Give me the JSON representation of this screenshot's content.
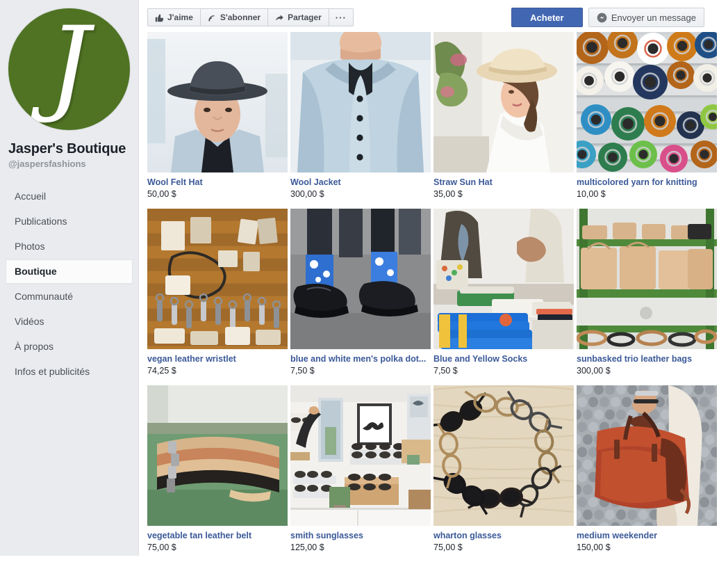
{
  "sidebar": {
    "logo_letter": "J",
    "logo_color": "#4f7322",
    "page_name": "Jasper's Boutique",
    "handle": "@jaspersfashions",
    "items": [
      {
        "label": "Accueil",
        "active": false
      },
      {
        "label": "Publications",
        "active": false
      },
      {
        "label": "Photos",
        "active": false
      },
      {
        "label": "Boutique",
        "active": true
      },
      {
        "label": "Communauté",
        "active": false
      },
      {
        "label": "Vidéos",
        "active": false
      },
      {
        "label": "À propos",
        "active": false
      },
      {
        "label": "Infos et publicités",
        "active": false
      }
    ]
  },
  "toolbar": {
    "like_label": "J'aime",
    "like_icon": "thumbs-up-icon",
    "follow_label": "S'abonner",
    "follow_icon": "rss-follow-icon",
    "share_label": "Partager",
    "share_icon": "share-arrow-icon",
    "more_label": "···",
    "more_icon": "ellipsis-icon",
    "buy_label": "Acheter",
    "message_label": "Envoyer un message",
    "message_icon": "messenger-icon",
    "primary_color": "#4267b2"
  },
  "shop": {
    "currency_suffix": "$",
    "products": [
      {
        "name": "Wool Felt Hat",
        "price": "50,00 $",
        "image": "man-in-grey-fedora-hat"
      },
      {
        "name": "Wool Jacket",
        "price": "300,00 $",
        "image": "light-blue-wool-coat"
      },
      {
        "name": "Straw Sun Hat",
        "price": "35,00 $",
        "image": "woman-in-straw-hat"
      },
      {
        "name": "multicolored yarn for knitting",
        "price": "10,00 $",
        "image": "colorful-yarn-spools"
      },
      {
        "name": "vegan leather wristlet",
        "price": "74,25 $",
        "image": "leather-goods-flatlay"
      },
      {
        "name": "blue and white men's polka dot...",
        "price": "7,50 $",
        "image": "polka-dot-socks-shoes"
      },
      {
        "name": "Blue and Yellow Socks",
        "price": "7,50 $",
        "image": "stacked-blue-socks"
      },
      {
        "name": "sunbasked trio leather bags",
        "price": "300,00 $",
        "image": "tan-bags-on-green-shelves"
      },
      {
        "name": "vegetable tan leather belt",
        "price": "75,00 $",
        "image": "stacked-leather-belts"
      },
      {
        "name": "smith sunglasses",
        "price": "125,00 $",
        "image": "eyewear-shop-interior"
      },
      {
        "name": "wharton glasses",
        "price": "75,00 $",
        "image": "glasses-circle-on-wood"
      },
      {
        "name": "medium weekender",
        "price": "150,00 $",
        "image": "red-leather-duffel-bag"
      }
    ]
  }
}
